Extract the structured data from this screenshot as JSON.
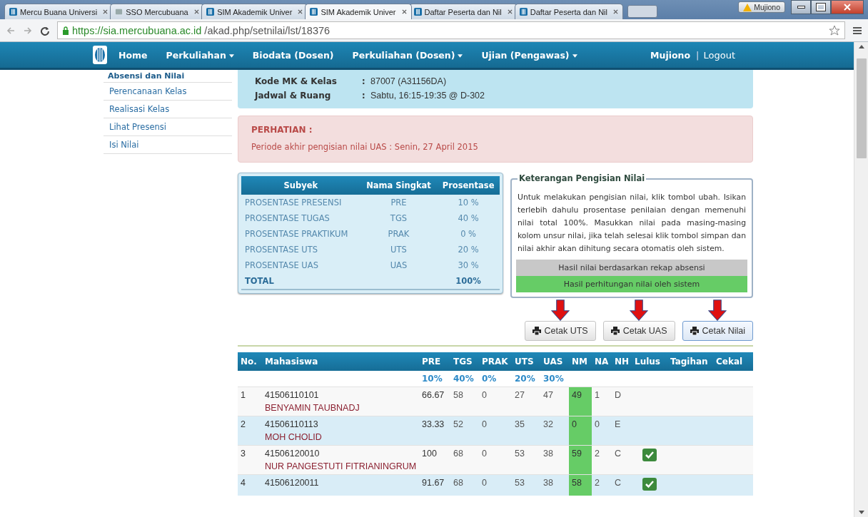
{
  "browser": {
    "tabs": [
      {
        "title": "Mercu Buana Universi",
        "selected": false
      },
      {
        "title": "SSO Mercubuana",
        "selected": false
      },
      {
        "title": "SIM Akademik Univer",
        "selected": false
      },
      {
        "title": "SIM Akademik Univer",
        "selected": true
      },
      {
        "title": "Daftar Peserta dan Nil",
        "selected": false
      },
      {
        "title": "Daftar Peserta dan Nil",
        "selected": false
      }
    ],
    "profile": "Mujiono",
    "url_host": "https://sia.mercubuana.ac.id",
    "url_path": "/akad.php/setnilai/lst/18376"
  },
  "navbar": {
    "items": [
      {
        "label": "Home",
        "dropdown": false
      },
      {
        "label": "Perkuliahan",
        "dropdown": true
      },
      {
        "label": "Biodata (Dosen)",
        "dropdown": false
      },
      {
        "label": "Perkuliahan (Dosen)",
        "dropdown": true
      },
      {
        "label": "Ujian (Pengawas)",
        "dropdown": true
      }
    ],
    "user": "Mujiono",
    "separator": "|",
    "logout": "Logout"
  },
  "sidebar": {
    "items": [
      {
        "label": "Absensi dan Nilai",
        "kind": "heading"
      },
      {
        "label": "Perencanaan Kelas",
        "kind": "link"
      },
      {
        "label": "Realisasi Kelas",
        "kind": "link"
      },
      {
        "label": "Lihat Presensi",
        "kind": "link"
      },
      {
        "label": "Isi Nilai",
        "kind": "link"
      }
    ]
  },
  "course_info": [
    {
      "label": "Kode MK & Kelas",
      "sep": ":",
      "value": "87007 (A31156DA)"
    },
    {
      "label": "Jadwal & Ruang",
      "sep": ":",
      "value": "Sabtu, 16:15-19:35 @ D-302"
    }
  ],
  "alert": {
    "title": "PERHATIAN :",
    "message": "Periode akhir pengisian nilai UAS : Senin, 27 April 2015"
  },
  "weights": {
    "columns": [
      "Subyek",
      "Nama Singkat",
      "Prosentase"
    ],
    "rows": [
      {
        "subject": "PROSENTASE PRESENSI",
        "short": "PRE",
        "percent": "10 %"
      },
      {
        "subject": "PROSENTASE TUGAS",
        "short": "TGS",
        "percent": "40 %"
      },
      {
        "subject": "PROSENTASE PRAKTIKUM",
        "short": "PRAK",
        "percent": "0 %"
      },
      {
        "subject": "PROSENTASE UTS",
        "short": "UTS",
        "percent": "20 %"
      },
      {
        "subject": "PROSENTASE UAS",
        "short": "UAS",
        "percent": "30 %"
      }
    ],
    "total": {
      "label": "TOTAL",
      "percent": "100%"
    }
  },
  "info_box": {
    "title": "Keterangan Pengisian Nilai",
    "text": "Untuk melakukan pengisian nilai, klik tombol ubah. Isikan terlebih dahulu prosentase penilaian dengan memenuhi nilai total 100%. Masukkan nilai pada masing-masing kolom unsur nilai, jika telah selesai klik tombol simpan dan nilai akhir akan dihitung secara otomatis oleh sistem.",
    "legend": [
      {
        "label": "Hasil nilai berdasarkan rekap absensi",
        "color": "#c8c8c8"
      },
      {
        "label": "Hasil perhitungan nilai oleh sistem",
        "color": "#66cc66"
      }
    ]
  },
  "print_buttons": [
    {
      "label": "Cetak UTS",
      "selected": false,
      "annotated": true
    },
    {
      "label": "Cetak UAS",
      "selected": false,
      "annotated": true
    },
    {
      "label": "Cetak Nilai",
      "selected": true,
      "annotated": true
    }
  ],
  "grades": {
    "columns": [
      "No.",
      "Mahasiswa",
      "PRE",
      "TGS",
      "PRAK",
      "UTS",
      "UAS",
      "NM",
      "NA",
      "NH",
      "Lulus",
      "Tagihan",
      "Cekal"
    ],
    "weights": [
      "10%",
      "40%",
      "0%",
      "20%",
      "30%"
    ],
    "rows": [
      {
        "no": "1",
        "nim": "41506110101",
        "name": "BENYAMIN TAUBNADJ",
        "pre": "66.67",
        "tgs": "58",
        "prak": "0",
        "uts": "27",
        "uas": "47",
        "nm": "49",
        "na": "1",
        "nh": "D",
        "passed": false
      },
      {
        "no": "2",
        "nim": "41506110113",
        "name": "MOH CHOLID",
        "pre": "33.33",
        "tgs": "52",
        "prak": "0",
        "uts": "35",
        "uas": "32",
        "nm": "0",
        "na": "0",
        "nh": "E",
        "passed": false
      },
      {
        "no": "3",
        "nim": "41506120010",
        "name": "NUR PANGESTUTI FITRIANINGRUM",
        "pre": "100",
        "tgs": "68",
        "prak": "0",
        "uts": "53",
        "uas": "38",
        "nm": "59",
        "na": "2",
        "nh": "C",
        "passed": true
      },
      {
        "no": "4",
        "nim": "41506120011",
        "pre": "91.67",
        "tgs": "68",
        "prak": "0",
        "uts": "53",
        "uas": "38",
        "nm": "58",
        "na": "2",
        "nh": "C",
        "passed": true
      }
    ]
  }
}
